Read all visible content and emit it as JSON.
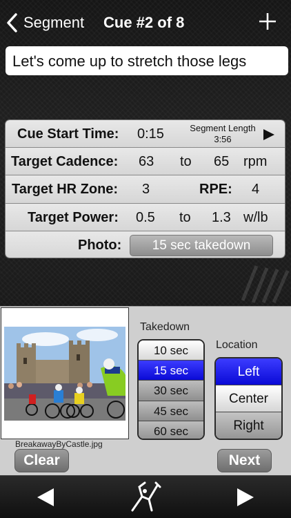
{
  "nav": {
    "back_label": "Segment",
    "title": "Cue #2 of 8"
  },
  "cue": {
    "text": "Let's come up to stretch those legs"
  },
  "params": {
    "cue_start": {
      "label": "Cue Start Time:",
      "value": "0:15"
    },
    "segment_length": {
      "label": "Segment Length",
      "value": "3:56"
    },
    "cadence": {
      "label": "Target Cadence:",
      "from": "63",
      "to_word": "to",
      "to": "65",
      "unit": "rpm"
    },
    "hr_zone": {
      "label": "Target HR Zone:",
      "value": "3"
    },
    "rpe": {
      "label": "RPE:",
      "value": "4"
    },
    "power": {
      "label": "Target Power:",
      "from": "0.5",
      "to_word": "to",
      "to": "1.3",
      "unit": "w/lb"
    },
    "photo": {
      "label": "Photo:",
      "value": "15 sec takedown"
    }
  },
  "photo_panel": {
    "filename": "BreakawayByCastle.jpg",
    "clear_label": "Clear",
    "next_label": "Next"
  },
  "takedown": {
    "label": "Takedown",
    "options": [
      "10 sec",
      "15 sec",
      "30 sec",
      "45 sec",
      "60 sec"
    ],
    "selected": "15 sec"
  },
  "location": {
    "label": "Location",
    "options": [
      "Left",
      "Center",
      "Right"
    ],
    "selected": "Left"
  },
  "colors": {
    "selected_blue": "#1414e6",
    "panel_bg": "#cfcfcf"
  },
  "toolbar": {
    "icons": [
      "previous-icon",
      "rider-logo-icon",
      "next-icon"
    ]
  }
}
